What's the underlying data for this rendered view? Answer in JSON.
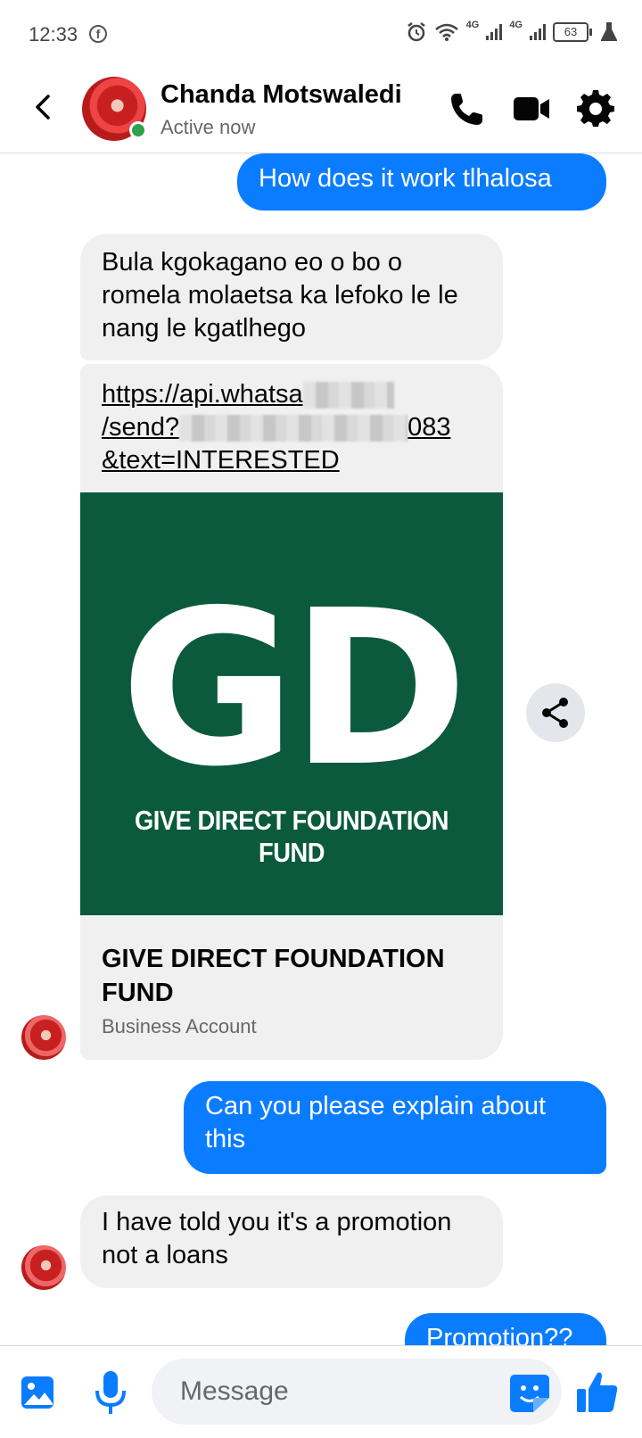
{
  "status_bar": {
    "time": "12:33",
    "network_1": "4G",
    "network_2": "4G",
    "battery": "63"
  },
  "header": {
    "contact_name": "Chanda Motswaledi",
    "status": "Active now"
  },
  "messages": [
    {
      "direction": "out",
      "text": "How does it work tlhalosa"
    },
    {
      "direction": "in",
      "text": "Bula kgokagano eo o bo o romela molaetsa ka lefoko le le nang le kgatlhego"
    },
    {
      "direction": "in",
      "link": {
        "line1": "https://api.whatsa",
        "line2_start": "/send?",
        "line2_end": "083",
        "line3": "&text=INTERESTED"
      },
      "card": {
        "image_letters": "GD",
        "image_caption": "GIVE DIRECT FOUNDATION FUND",
        "title": "GIVE DIRECT FOUNDATION FUND",
        "subtitle": "Business Account"
      }
    },
    {
      "direction": "out",
      "text": "Can you please explain about this"
    },
    {
      "direction": "in",
      "text": "I have told you it's a promotion not a loans"
    },
    {
      "direction": "out",
      "text": "Promotion??"
    }
  ],
  "composer": {
    "placeholder": "Message"
  },
  "colors": {
    "outgoing_bubble": "#0a7cff",
    "incoming_bubble": "#f0f0f0",
    "brand_blue": "#0a7cff",
    "online": "#31a24c",
    "gd_background": "#0b5a3d"
  },
  "icons": [
    "facebook-icon",
    "alarm-icon",
    "wifi-icon",
    "signal-icon",
    "battery-icon",
    "flask-icon",
    "back-arrow-icon",
    "phone-icon",
    "video-icon",
    "gear-icon",
    "share-icon",
    "image-icon",
    "microphone-icon",
    "sticker-icon",
    "thumbs-up-icon"
  ]
}
